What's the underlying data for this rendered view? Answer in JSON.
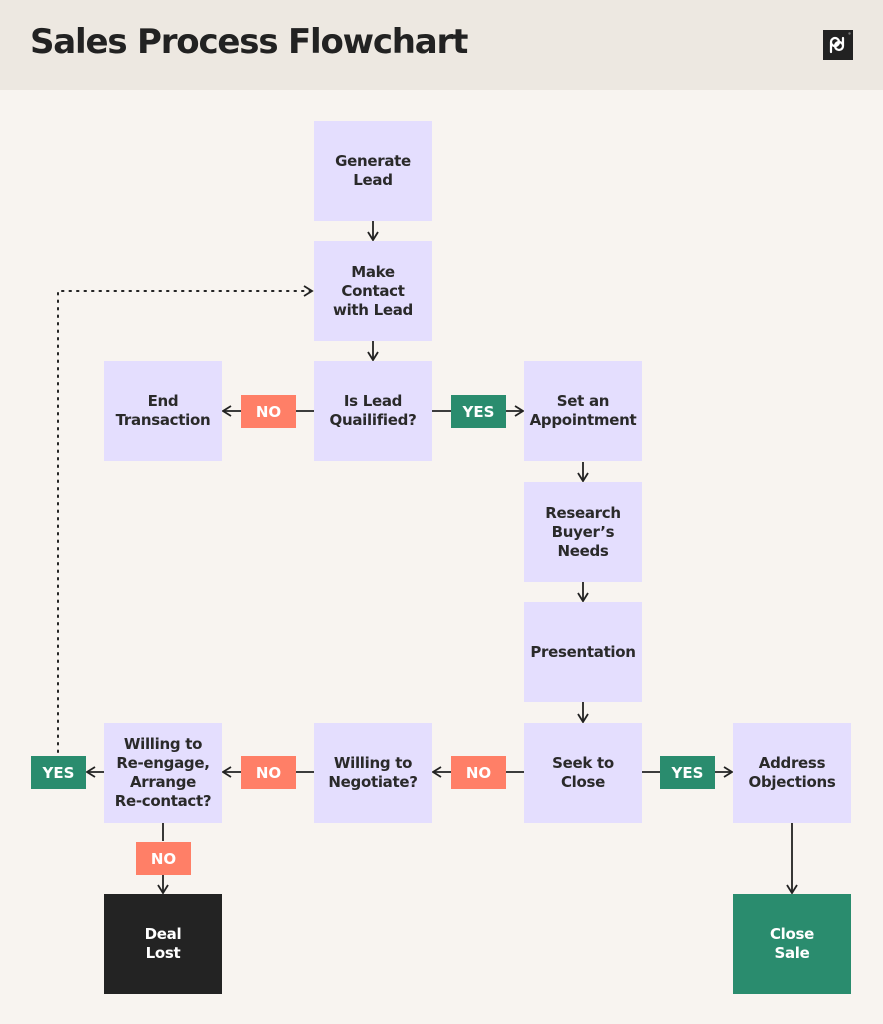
{
  "header": {
    "title": "Sales Process Flowchart",
    "logo": "pd-logo"
  },
  "colors": {
    "process_box": "#E4DEFE",
    "no_badge": "#FF7F67",
    "yes_badge": "#2A8C6E",
    "deal_lost": "#232323",
    "close_sale": "#2A8C6E",
    "background": "#F8F4F0",
    "header_bg": "#EDE8E1"
  },
  "nodes": {
    "generate_lead": "Generate\nLead",
    "make_contact": "Make\nContact\nwith Lead",
    "is_lead_qualified": "Is Lead\nQuailified?",
    "end_transaction": "End\nTransaction",
    "set_appointment": "Set an\nAppointment",
    "research_needs": "Research\nBuyer’s\nNeeds",
    "presentation": "Presentation",
    "seek_to_close": "Seek to\nClose",
    "address_objections": "Address\nObjections",
    "willing_to_negotiate": "Willing to\nNegotiate?",
    "willing_to_reengage": "Willing to\nRe-engage,\nArrange\nRe-contact?",
    "deal_lost": "Deal\nLost",
    "close_sale": "Close\nSale"
  },
  "badges": {
    "qualified_no": "NO",
    "qualified_yes": "YES",
    "close_yes": "YES",
    "close_no": "NO",
    "negotiate_no": "NO",
    "reengage_yes": "YES",
    "reengage_no": "NO"
  }
}
